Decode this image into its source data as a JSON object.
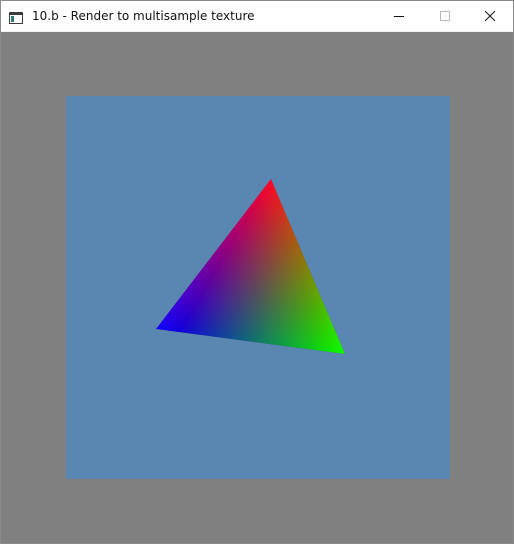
{
  "window": {
    "title": "10.b - Render to multisample texture",
    "icon": "app-window-icon",
    "buttons": {
      "minimize": "minimize-icon",
      "maximize": "maximize-icon",
      "close": "close-icon"
    }
  },
  "scene": {
    "clear_color": "#808080",
    "texture_color": "#5a87b2",
    "triangle": {
      "vertices": [
        {
          "name": "red-vertex",
          "color": "#ff0000"
        },
        {
          "name": "green-vertex",
          "color": "#00ff00"
        },
        {
          "name": "blue-vertex",
          "color": "#0000ff"
        }
      ]
    }
  }
}
